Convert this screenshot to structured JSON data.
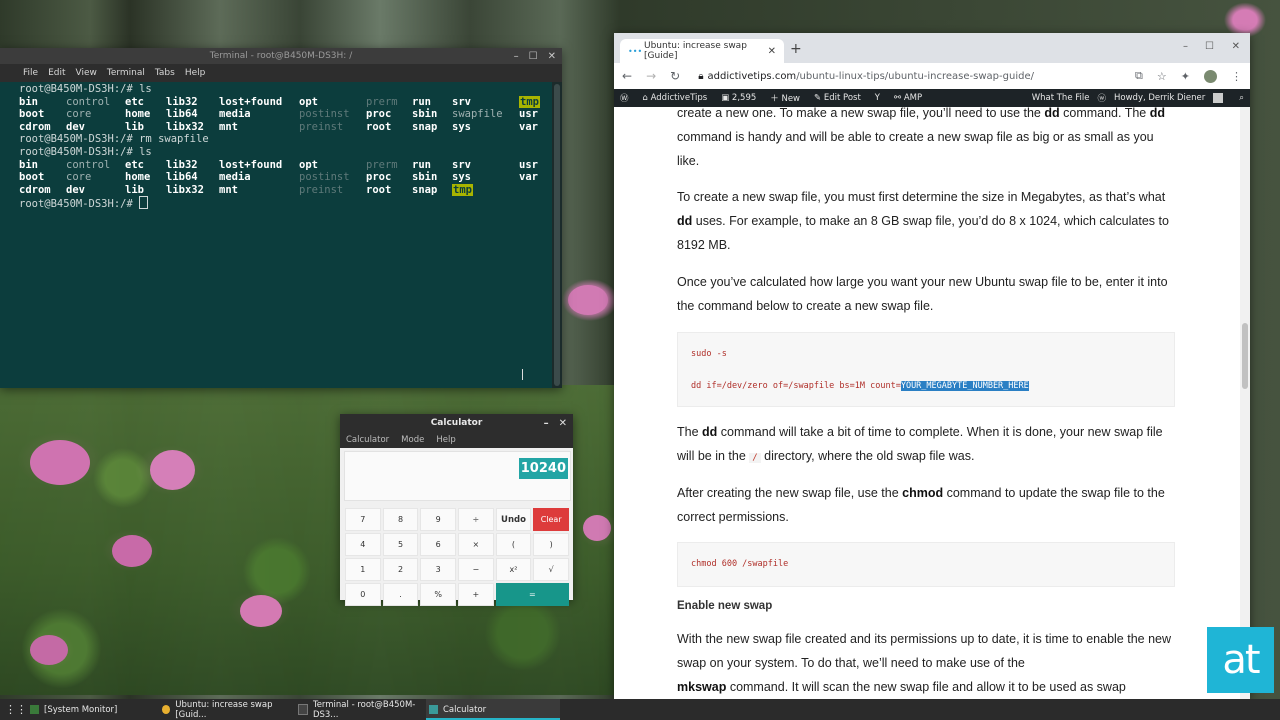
{
  "terminal": {
    "title": "Terminal - root@B450M-DS3H: /",
    "menu": [
      "File",
      "Edit",
      "View",
      "Terminal",
      "Tabs",
      "Help"
    ],
    "lines": [
      {
        "prompt": "root@B450M-DS3H:/# ls"
      },
      {
        "cols": [
          [
            "bin",
            "dir"
          ],
          [
            "control",
            "link"
          ],
          [
            "etc",
            "dir"
          ],
          [
            "lib32",
            "dir"
          ],
          [
            "lost+found",
            "dir"
          ],
          [
            "opt",
            "dir"
          ],
          [
            "prerm",
            "dim"
          ],
          [
            "run",
            "dir"
          ],
          [
            "srv",
            "dir"
          ],
          [
            "tmp",
            "hl"
          ]
        ]
      },
      {
        "cols": [
          [
            "boot",
            "dir"
          ],
          [
            "core",
            "link"
          ],
          [
            "home",
            "dir"
          ],
          [
            "lib64",
            "dir"
          ],
          [
            "media",
            "dir"
          ],
          [
            "postinst",
            "dim"
          ],
          [
            "proc",
            "dir"
          ],
          [
            "sbin",
            "dir"
          ],
          [
            "swapfile",
            "link"
          ],
          [
            "usr",
            "dir"
          ]
        ]
      },
      {
        "cols": [
          [
            "cdrom",
            "dir"
          ],
          [
            "dev",
            "dir"
          ],
          [
            "lib",
            "dir"
          ],
          [
            "libx32",
            "dir"
          ],
          [
            "mnt",
            "dir"
          ],
          [
            "preinst",
            "dim"
          ],
          [
            "root",
            "dir"
          ],
          [
            "snap",
            "dir"
          ],
          [
            "sys",
            "dir"
          ],
          [
            "var",
            "dir"
          ]
        ]
      },
      {
        "prompt": "root@B450M-DS3H:/# rm swapfile"
      },
      {
        "prompt": "root@B450M-DS3H:/# ls"
      },
      {
        "cols": [
          [
            "bin",
            "dir"
          ],
          [
            "control",
            "link"
          ],
          [
            "etc",
            "dir"
          ],
          [
            "lib32",
            "dir"
          ],
          [
            "lost+found",
            "dir"
          ],
          [
            "opt",
            "dir"
          ],
          [
            "prerm",
            "dim"
          ],
          [
            "run",
            "dir"
          ],
          [
            "srv",
            "dir"
          ],
          [
            "usr",
            "dir"
          ]
        ]
      },
      {
        "cols": [
          [
            "boot",
            "dir"
          ],
          [
            "core",
            "link"
          ],
          [
            "home",
            "dir"
          ],
          [
            "lib64",
            "dir"
          ],
          [
            "media",
            "dir"
          ],
          [
            "postinst",
            "dim"
          ],
          [
            "proc",
            "dir"
          ],
          [
            "sbin",
            "dir"
          ],
          [
            "sys",
            "dir"
          ],
          [
            "var",
            "dir"
          ]
        ]
      },
      {
        "cols": [
          [
            "cdrom",
            "dir"
          ],
          [
            "dev",
            "dir"
          ],
          [
            "lib",
            "dir"
          ],
          [
            "libx32",
            "dir"
          ],
          [
            "mnt",
            "dir"
          ],
          [
            "preinst",
            "dim"
          ],
          [
            "root",
            "dir"
          ],
          [
            "snap",
            "dir"
          ],
          [
            "tmp",
            "hl"
          ]
        ]
      },
      {
        "prompt": "root@B450M-DS3H:/# ",
        "cursor": true
      }
    ]
  },
  "calculator": {
    "title": "Calculator",
    "menu": [
      "Calculator",
      "Mode",
      "Help"
    ],
    "display": "10240",
    "keys": [
      {
        "label": "7"
      },
      {
        "label": "8"
      },
      {
        "label": "9"
      },
      {
        "label": "÷"
      },
      {
        "label": "Undo",
        "kind": "bold"
      },
      {
        "label": "Clear",
        "kind": "clear"
      },
      {
        "label": "4"
      },
      {
        "label": "5"
      },
      {
        "label": "6"
      },
      {
        "label": "×"
      },
      {
        "label": "("
      },
      {
        "label": ")"
      },
      {
        "label": "1"
      },
      {
        "label": "2"
      },
      {
        "label": "3"
      },
      {
        "label": "−"
      },
      {
        "label": "x²"
      },
      {
        "label": "√"
      },
      {
        "label": "0"
      },
      {
        "label": "."
      },
      {
        "label": "%"
      },
      {
        "label": "+"
      },
      {
        "label": "=",
        "kind": "equals"
      }
    ]
  },
  "browser": {
    "tab_title": "Ubuntu: increase swap [Guide]",
    "url_host": "addictivetips.com",
    "url_path": "/ubuntu-linux-tips/ubuntu-increase-swap-guide/",
    "wp_bar": {
      "site": "AddictiveTips",
      "comments": "2,595",
      "new": "New",
      "edit": "Edit Post",
      "amp": "AMP",
      "right_text": "What The File",
      "howdy": "Howdy, Derrik Diener"
    }
  },
  "article": {
    "p1": {
      "a": "create a new one. To make a new swap file, you’ll need to use the ",
      "b": "dd",
      "c": " command. The ",
      "d": "dd",
      "e": " command is handy and will be able to create a new swap file as big or as small as you like."
    },
    "p2": {
      "a": "To create a new swap file, you must first determine the size in Megabytes, as that’s what ",
      "b": "dd",
      "c": " uses. For example, to make an 8 GB swap file, you’d do 8 x 1024, which calculates to 8192 MB."
    },
    "p3": "Once you’ve calculated how large you want your new Ubuntu swap file to be, enter it into the command below to create a new swap file.",
    "code1_line1": "sudo -s",
    "code1_line2": "dd if=/dev/zero of=/swapfile bs=1M count=",
    "code1_highlight": "YOUR_MEGABYTE_NUMBER_HERE",
    "p4": {
      "a": "The ",
      "b": "dd",
      "c": " command will take a bit of time to complete. When it is done, your new swap file will be in the ",
      "code": "/",
      "d": " directory, where the old swap file was."
    },
    "p5": {
      "a": "After creating the new swap file, use the ",
      "b": "chmod",
      "c": " command to update the swap file to the correct permissions."
    },
    "code2": "chmod 600 /swapfile",
    "heading": "Enable new swap",
    "p6": "With the new swap file created and its permissions up to date, it is time to enable the new swap on your system. To do that, we’ll need to make use of the",
    "p7": {
      "b": "mkswap",
      "c": " command. It will scan the new swap file and allow it to be used as swap"
    }
  },
  "logo": "at",
  "taskbar": {
    "items": [
      {
        "label": "[System Monitor]",
        "icon": "monitor-icon",
        "color": "#3a7a3a"
      },
      {
        "label": "Ubuntu: increase swap [Guid...",
        "icon": "chrome-icon",
        "color": "#e8b030"
      },
      {
        "label": "Terminal - root@B450M-DS3...",
        "icon": "terminal-icon",
        "color": "#444444"
      },
      {
        "label": "Calculator",
        "icon": "calculator-icon",
        "color": "#3a9a9a"
      }
    ]
  }
}
